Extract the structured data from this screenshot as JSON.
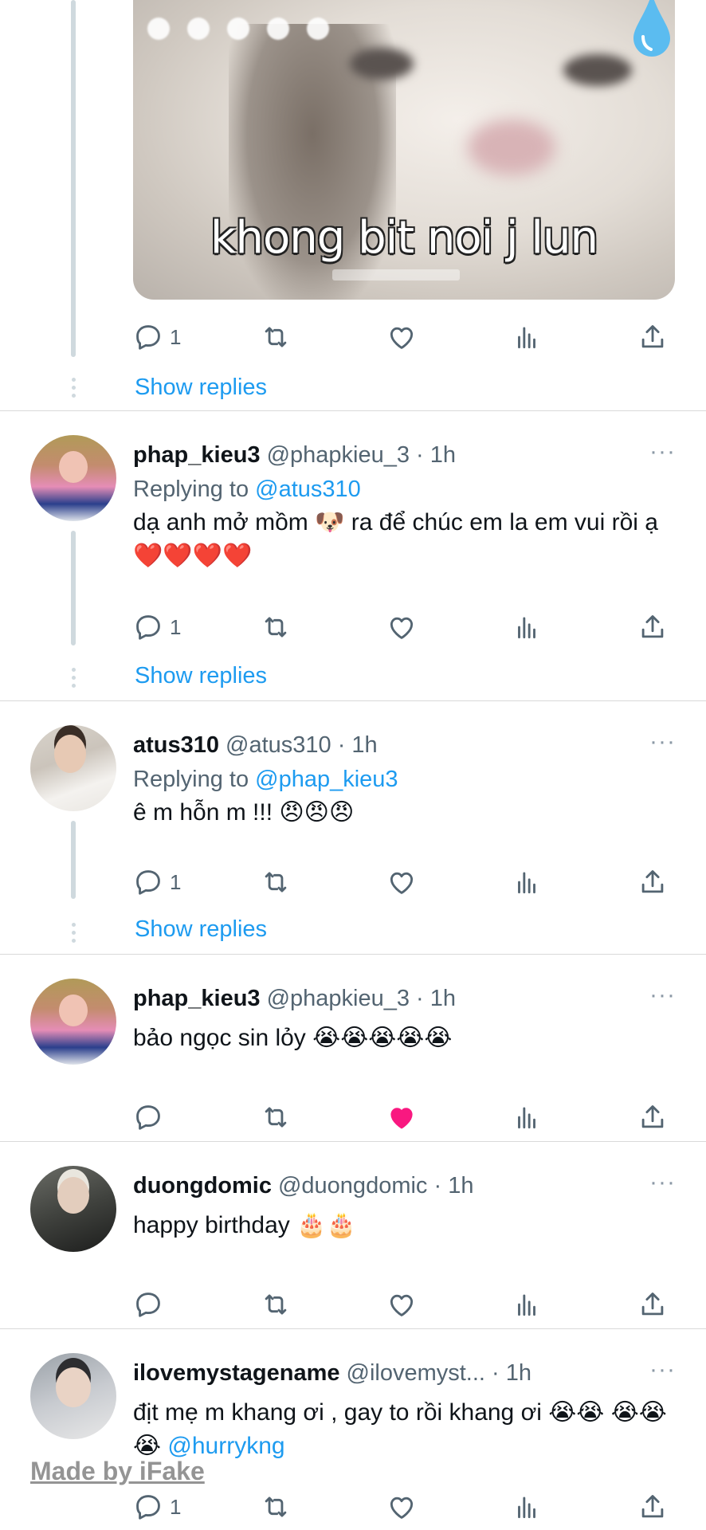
{
  "first": {
    "media_caption": "khong bit noi j lun",
    "reply_count": "1",
    "show_replies": "Show replies"
  },
  "tweets": [
    {
      "name": "phap_kieu3",
      "handle": "@phapkieu_3 · 1h",
      "replying_prefix": "Replying to",
      "replying_to": "@atus310",
      "text": "dạ anh mở mồm 🐶 ra để chúc em la em vui rồi ạ ❤️❤️❤️❤️",
      "reply_count": "1",
      "liked": false,
      "show_replies": "Show replies"
    },
    {
      "name": "atus310",
      "handle": "@atus310 · 1h",
      "replying_prefix": "Replying to",
      "replying_to": "@phap_kieu3",
      "text": "ê m hỗn m !!! 😠😠😠",
      "reply_count": "1",
      "liked": false,
      "show_replies": "Show replies"
    },
    {
      "name": "phap_kieu3",
      "handle": "@phapkieu_3 · 1h",
      "text": "bảo ngọc sin lỏy 😭😭😭😭😭",
      "reply_count": "",
      "liked": true
    },
    {
      "name": "duongdomic",
      "handle": "@duongdomic · 1h",
      "text": "happy birthday 🎂🎂",
      "reply_count": "",
      "liked": false
    },
    {
      "name": "ilovemystagename",
      "handle": "@ilovemyst... · 1h",
      "text": "địt mẹ m khang ơi , gay to rồi khang ơi 😭😭",
      "text2": "😭😭😭",
      "mention": "@hurrykng",
      "reply_count": "1",
      "liked": false
    }
  ],
  "more_glyph": "···",
  "watermark": "Made by iFake",
  "colors": {
    "link": "#1d9bf0",
    "muted": "#536471",
    "like_active": "#f91880",
    "divider": "#d9d9d9"
  }
}
